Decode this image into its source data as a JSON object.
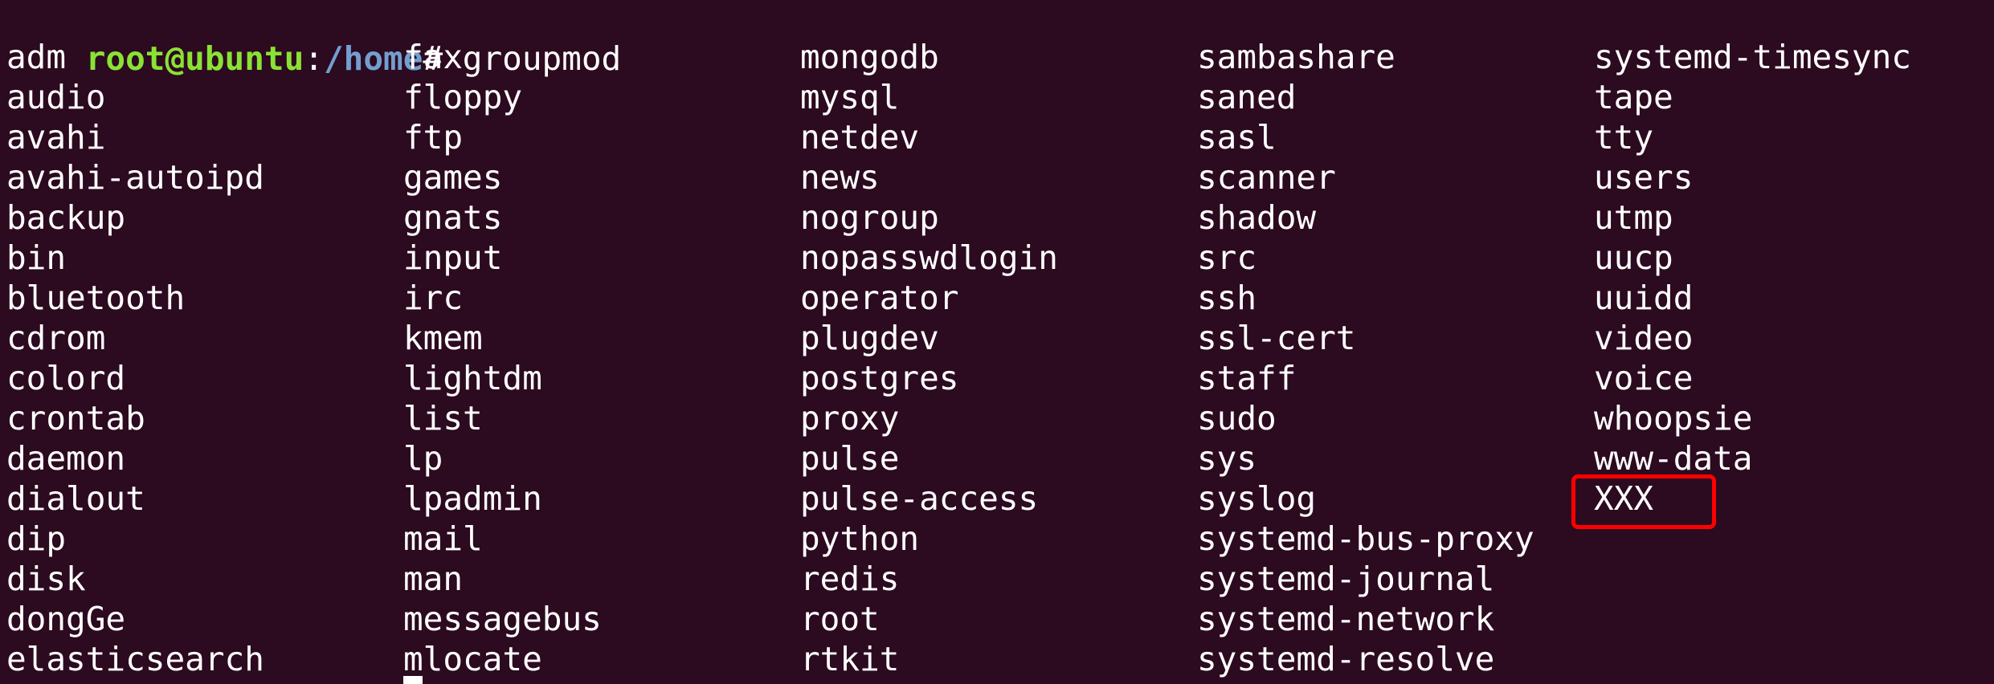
{
  "terminal": {
    "prompt": {
      "user_host": "root@ubuntu",
      "separator": ":",
      "path": "/home",
      "symbol": "# ",
      "command": "groupmod"
    },
    "columns": [
      [
        "adm",
        "audio",
        "avahi",
        "avahi-autoipd",
        "backup",
        "bin",
        "bluetooth",
        "cdrom",
        "colord",
        "crontab",
        "daemon",
        "dialout",
        "dip",
        "disk",
        "dongGe",
        "elasticsearch"
      ],
      [
        "fax",
        "floppy",
        "ftp",
        "games",
        "gnats",
        "input",
        "irc",
        "kmem",
        "lightdm",
        "list",
        "lp",
        "lpadmin",
        "mail",
        "man",
        "messagebus",
        "mlocate"
      ],
      [
        "mongodb",
        "mysql",
        "netdev",
        "news",
        "nogroup",
        "nopasswdlogin",
        "operator",
        "plugdev",
        "postgres",
        "proxy",
        "pulse",
        "pulse-access",
        "python",
        "redis",
        "root",
        "rtkit"
      ],
      [
        "sambashare",
        "saned",
        "sasl",
        "scanner",
        "shadow",
        "src",
        "ssh",
        "ssl-cert",
        "staff",
        "sudo",
        "sys",
        "syslog",
        "systemd-bus-proxy",
        "systemd-journal",
        "systemd-network",
        "systemd-resolve"
      ],
      [
        "systemd-timesync",
        "tape",
        "tty",
        "users",
        "utmp",
        "uucp",
        "uuidd",
        "video",
        "voice",
        "whoopsie",
        "www-data",
        "XXX"
      ]
    ]
  },
  "colors": {
    "background": "#2c0a1f",
    "text": "#ffffff",
    "user_host": "#8ae234",
    "path": "#729fcf",
    "highlight": "#ff0000"
  }
}
